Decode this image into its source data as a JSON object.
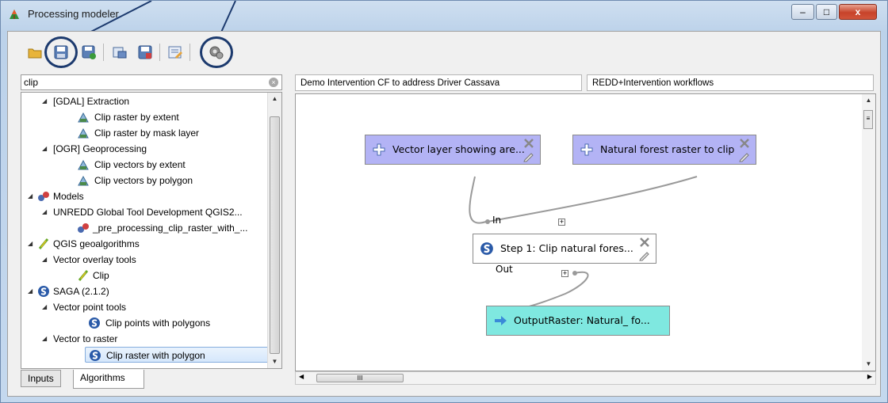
{
  "window": {
    "title": "Processing modeler",
    "controls": {
      "minimize": "–",
      "maximize": "□",
      "close": "x"
    }
  },
  "toolbar": {
    "buttons": [
      "open-model-icon",
      "save-model-icon",
      "save-as-icon",
      "export-image-icon",
      "save-to-file-icon",
      "edit-help-icon",
      "run-model-icon"
    ],
    "highlighted": [
      "save-model-icon",
      "run-model-icon"
    ],
    "highlight_color": "#1c3a6e"
  },
  "search": {
    "value": "clip",
    "placeholder": ""
  },
  "tree": {
    "items": [
      {
        "label": "[GDAL] Extraction",
        "icon": ""
      },
      {
        "label": "Clip raster by extent",
        "icon": "gdal-tool-icon"
      },
      {
        "label": "Clip raster by mask layer",
        "icon": "gdal-tool-icon"
      },
      {
        "label": "[OGR] Geoprocessing",
        "icon": ""
      },
      {
        "label": "Clip vectors by extent",
        "icon": "gdal-tool-icon"
      },
      {
        "label": "Clip vectors by polygon",
        "icon": "gdal-tool-icon"
      },
      {
        "label": "Models",
        "icon": "models-icon"
      },
      {
        "label": "UNREDD Global Tool Development QGIS2...",
        "icon": ""
      },
      {
        "label": "_pre_processing_clip_raster_with_...",
        "icon": "models-icon"
      },
      {
        "label": "QGIS geoalgorithms",
        "icon": "qgis-icon"
      },
      {
        "label": "Vector overlay tools",
        "icon": ""
      },
      {
        "label": "Clip",
        "icon": "qgis-icon"
      },
      {
        "label": "SAGA (2.1.2)",
        "icon": "saga-icon"
      },
      {
        "label": "Vector point tools",
        "icon": ""
      },
      {
        "label": "Clip points with polygons",
        "icon": "saga-icon"
      },
      {
        "label": "Vector to raster",
        "icon": ""
      },
      {
        "label": "Clip raster with polygon",
        "icon": "saga-icon"
      }
    ],
    "selected": "Clip raster with polygon"
  },
  "left_tabs": [
    "Inputs",
    "Algorithms"
  ],
  "active_left_tab": "Algorithms",
  "model_fields": {
    "name": "Demo Intervention CF to address Driver Cassava",
    "group": "REDD+Intervention workflows"
  },
  "canvas": {
    "nodes": {
      "input1": {
        "label": "Vector layer showing are...",
        "type": "input"
      },
      "input2": {
        "label": "Natural forest raster to clip",
        "type": "input"
      },
      "step1": {
        "label": "Step 1: Clip natural fores...",
        "type": "algorithm"
      },
      "output": {
        "label": "OutputRaster: Natural_ fo...",
        "type": "output"
      }
    },
    "ports": {
      "in": "In",
      "out": "Out"
    },
    "colors": {
      "input": "#b3b3f5",
      "algorithm": "#ffffff",
      "output": "#7fe8e0",
      "link": "#9a9a9a"
    }
  },
  "hscroll": {
    "thumb": "III"
  }
}
